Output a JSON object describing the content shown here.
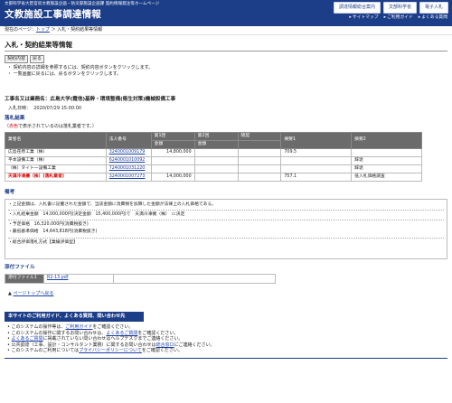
{
  "header": {
    "org": "文部科学省大臣官房文教施設企画・防災部施設企画課 契約情報発注等ホームページ",
    "title": "文教施設工事調達情報",
    "buttons": [
      "調達情報総合案内",
      "文部科学省",
      "電子入札"
    ],
    "links": [
      "サイトマップ",
      "ご利用ガイド",
      "よくある質問"
    ]
  },
  "breadcrumb": {
    "prefix": "現在のページ：",
    "top": "トップ",
    "sep": "＞",
    "current": "入札・契約結果等情報"
  },
  "page_title": "入札・契約結果等情報",
  "buttons": {
    "contract": "契約内容",
    "back": "戻る"
  },
  "instructions": [
    "・ 契約内容の詳細を参照するには、契約内容ボタンをクリックします。",
    "・ 一覧画面に戻るには、戻るボタンをクリックします。"
  ],
  "project": {
    "name": "工事名又は業務名：広島大学(霞他)基幹・環境整備(衛生対策)機械設備工事",
    "date_label": "入札日時：",
    "date": "2020/07/29 15:00:00"
  },
  "results": {
    "heading": "落札結果",
    "note_pre": "（",
    "note_red": "赤色",
    "note_post": "で表示されているのは落札業者です。）",
    "columns": [
      "業者名",
      "法人番号",
      "第1回",
      "第2回",
      "随契",
      "摘要1",
      "摘要2"
    ],
    "sub_columns": [
      "金額",
      "金額"
    ],
    "rows": [
      {
        "name": "広島荏原工業（株）",
        "corp": "3240001009179",
        "r1": "14,800,000",
        "r2": "",
        "zuikei": "",
        "note1": "709.5",
        "note2": "",
        "winner": false
      },
      {
        "name": "平本設備工業（株）",
        "corp": "6240001010092",
        "r1": "",
        "r2": "",
        "zuikei": "",
        "note1": "",
        "note2": "辞退",
        "winner": false
      },
      {
        "name": "（株）タイト一設備工業",
        "corp": "7240001031220",
        "r1": "",
        "r2": "",
        "zuikei": "",
        "note1": "",
        "note2": "辞退",
        "winner": false
      },
      {
        "name": "天満冷凍機（株）(落札業者)",
        "corp": "3240001007273",
        "r1": "14,000,000",
        "r2": "",
        "zuikei": "",
        "note1": "757.1",
        "note2": "低入札価格調査",
        "winner": true
      }
    ]
  },
  "remarks": {
    "heading": "備考",
    "lines": [
      "・上記金額は、入札書に記載された金額で、当該金額に消費税を加算した金額が法律上の入札価格である。",
      "・入札結果金額　14,000,000円(決定金額　15,400,000円)で　天満冷凍機（株）　に決定",
      "・予定価格　16,320,000円(消費税抜き)",
      "・最低基準価格　14,643,818円(消費税抜き)",
      "・総合評価落札方式【業績評価型】"
    ]
  },
  "attachments": {
    "heading": "添付ファイル",
    "label": "添付ファイル1",
    "file": "R2-13.pdf"
  },
  "page_top": "ページトップへ戻る",
  "footer": {
    "heading": "本サイトのご利用ガイド、よくある質問、問い合わせ先",
    "items": [
      {
        "pre": "このシステムの操作等は、",
        "link": "ご利用ガイド",
        "post": "をご確認ください。"
      },
      {
        "pre": "このシステムの操作に関するお問い合わせは、",
        "link": "よくあるご質問",
        "post": "をご確認ください。"
      },
      {
        "pre": "",
        "link": "よくあるご質問",
        "post": "に掲載されていない問い合わせはヘルプデスクまでご連絡ください。"
      },
      {
        "pre": "公共調達（工事、設計・コンサルタント業務）に関するお問い合わせは",
        "link": "総合窓口",
        "post": "にご連絡ください。"
      },
      {
        "pre": "このシステムのご利用については",
        "link": "プライバシーポリシーについて",
        "post": "をご確認ください。"
      }
    ]
  }
}
